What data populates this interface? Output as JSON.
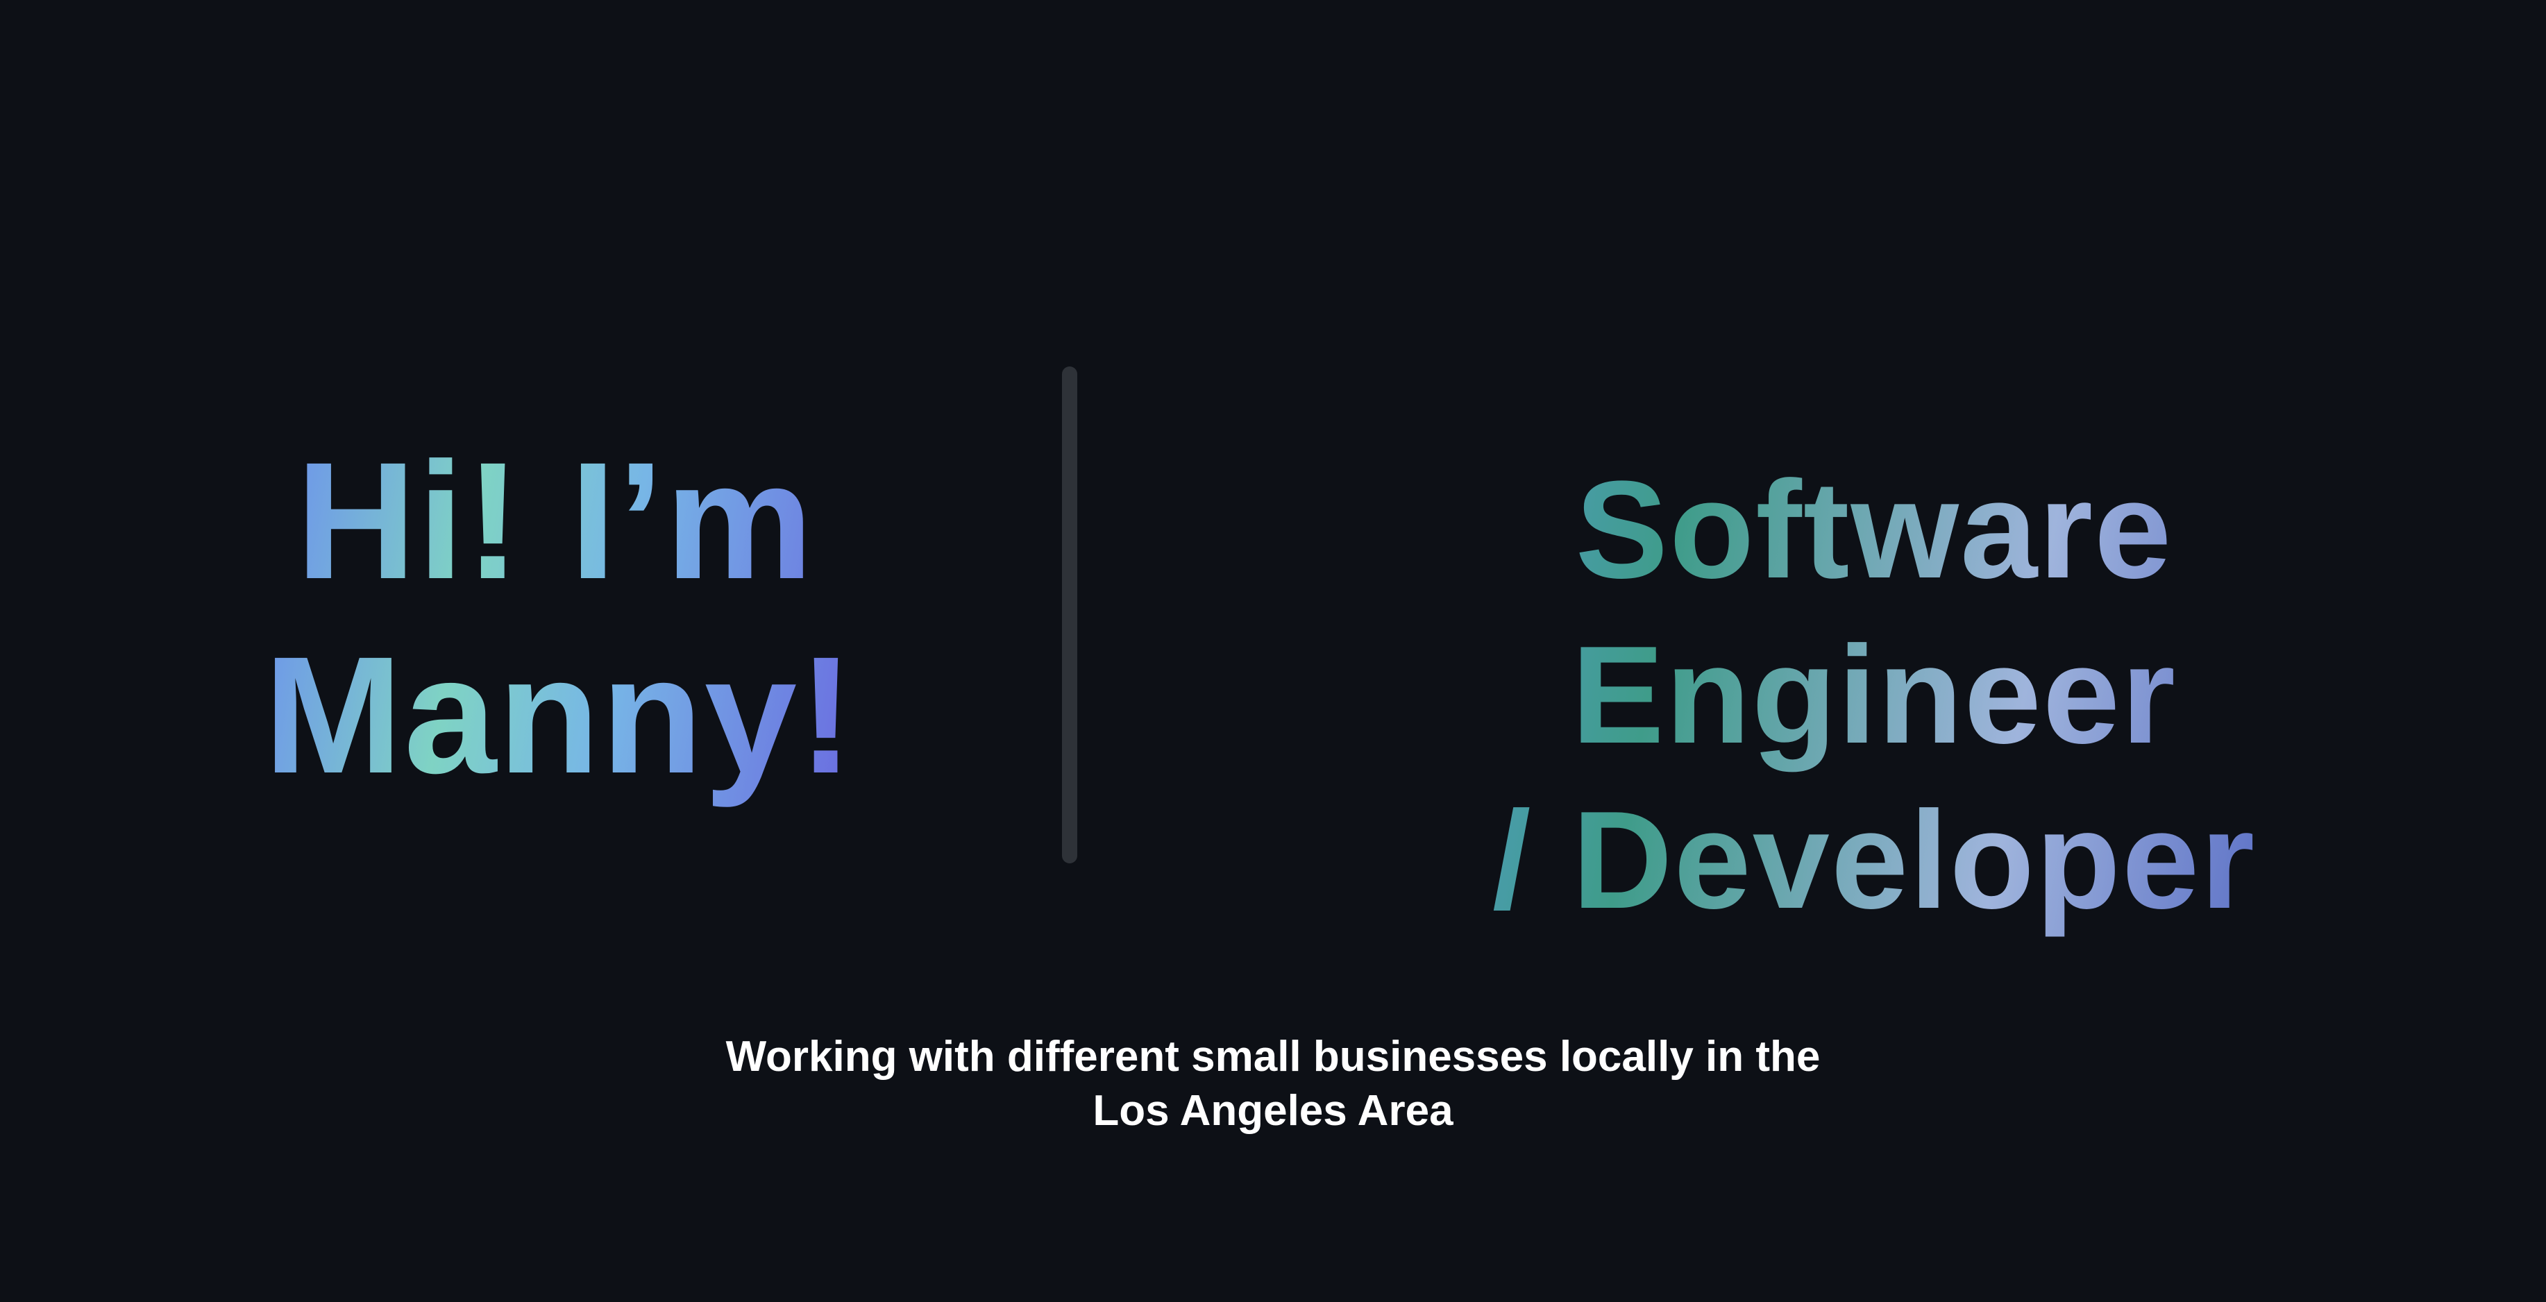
{
  "hero": {
    "greeting_line1": "Hi! I’m",
    "greeting_line2": "Manny!",
    "role_line1": "Software Engineer",
    "role_line2": "/ Developer",
    "tagline_line1": "Working with different small businesses locally in the",
    "tagline_line2": "Los Angeles Area"
  },
  "colors": {
    "background": "#0d1016",
    "divider": "#2e3238",
    "tagline": "#ffffff",
    "greeting_gradient": [
      "#6b8cf0",
      "#7fd3c4",
      "#77b6e6",
      "#6a6de0"
    ],
    "role_gradient": [
      "#5c9de8",
      "#3f9c8a",
      "#9fb4dc",
      "#2f43b8"
    ]
  }
}
